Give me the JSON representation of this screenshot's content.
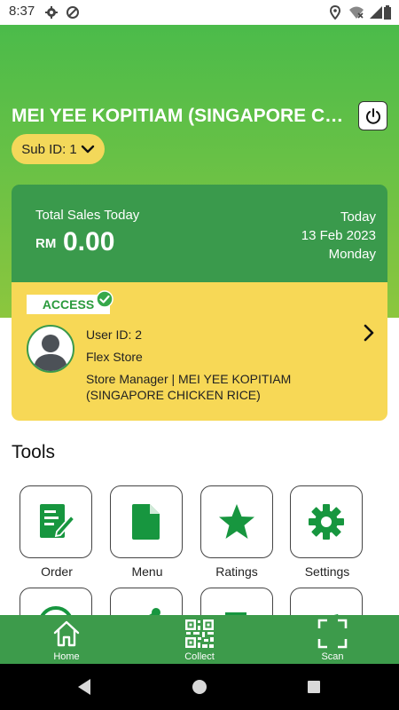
{
  "status_bar": {
    "time": "8:37"
  },
  "header": {
    "store_name": "MEI YEE KOPITIAM (SINGAPORE CHICKEN RICE)",
    "sub_id_label": "Sub ID: 1"
  },
  "sales": {
    "label": "Total Sales Today",
    "currency": "RM",
    "amount": "0.00",
    "day_label": "Today",
    "date": "13 Feb 2023",
    "weekday": "Monday"
  },
  "access": {
    "tag": "ACCESS",
    "user_id": "User ID: 2",
    "store_type": "Flex Store",
    "role": "Store Manager | MEI YEE KOPITIAM (SINGAPORE CHICKEN RICE)"
  },
  "tools": {
    "title": "Tools",
    "items": [
      {
        "label": "Order",
        "icon": "order-form-icon"
      },
      {
        "label": "Menu",
        "icon": "document-icon"
      },
      {
        "label": "Ratings",
        "icon": "star-icon"
      },
      {
        "label": "Settings",
        "icon": "gear-icon"
      }
    ]
  },
  "bottom_nav": {
    "items": [
      {
        "label": "Home",
        "icon": "home-icon"
      },
      {
        "label": "Collect",
        "icon": "qr-code-icon"
      },
      {
        "label": "Scan",
        "icon": "scan-frame-icon"
      }
    ]
  },
  "colors": {
    "brand_green": "#3a9a4c",
    "accent_yellow": "#f7d856",
    "header_gradient_top": "#4bbb4a",
    "header_gradient_bottom": "#8cc63e"
  }
}
